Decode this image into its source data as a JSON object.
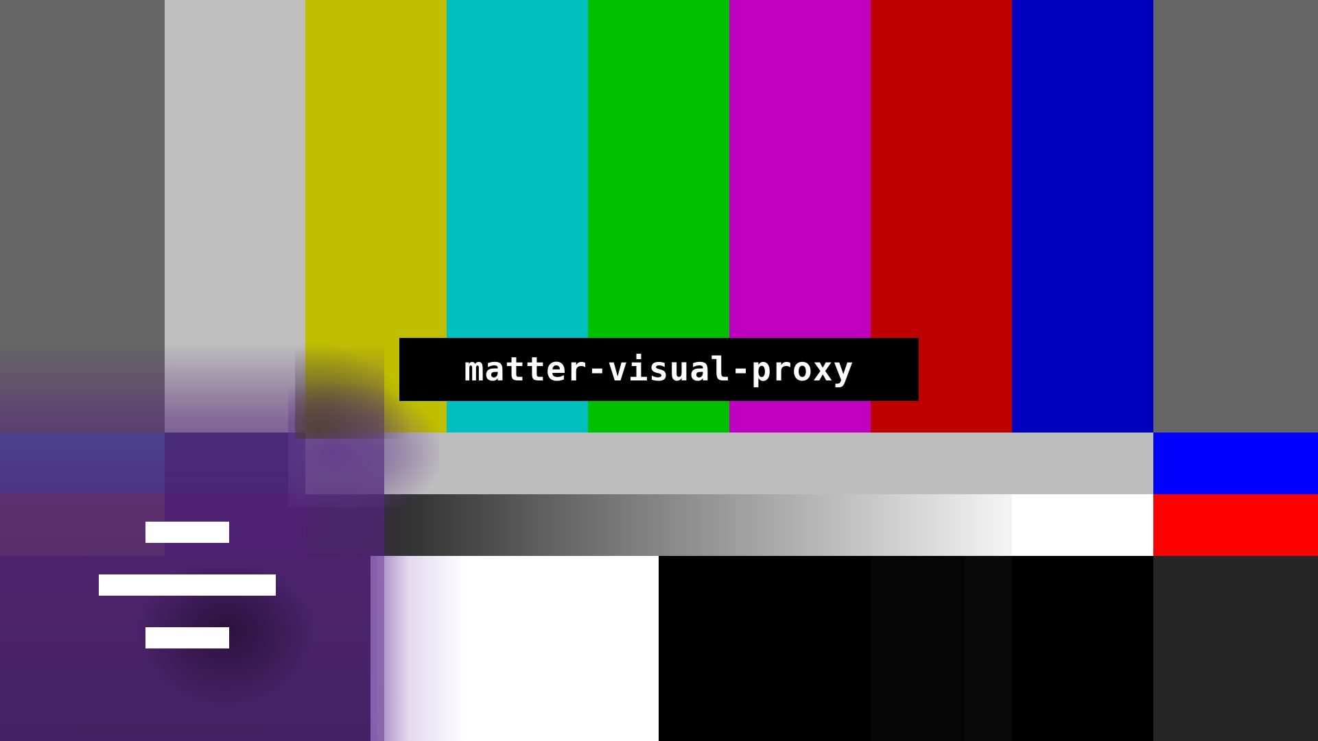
{
  "test_card": {
    "label": "matter-visual-proxy",
    "row1_colors": [
      "#666666",
      "#bfbfbf",
      "#bfbf00",
      "#00bfbf",
      "#00bf00",
      "#bf00bf",
      "#bf0000",
      "#0000bf",
      "#666666"
    ],
    "row2_colors": [
      "#3f6ab0",
      "#3a2f7a",
      "#bebebe",
      "#0000ff"
    ],
    "row3_colors": [
      "#8a6060",
      "#4e1a78",
      "linear-gradient(to right, #3b2050 0%, #333333 15%, #7a7a7a 45%, #bdbdbd 75%, #f5f5f5 100%)",
      "#ffffff",
      "#ff0000"
    ],
    "row4_colors": [
      "#4a2a62",
      "#ffffff",
      "#000000",
      "#050505",
      "#0a0a0a",
      "#000000",
      "#262626"
    ],
    "accent": "#000000",
    "text_color": "#ffffff"
  }
}
